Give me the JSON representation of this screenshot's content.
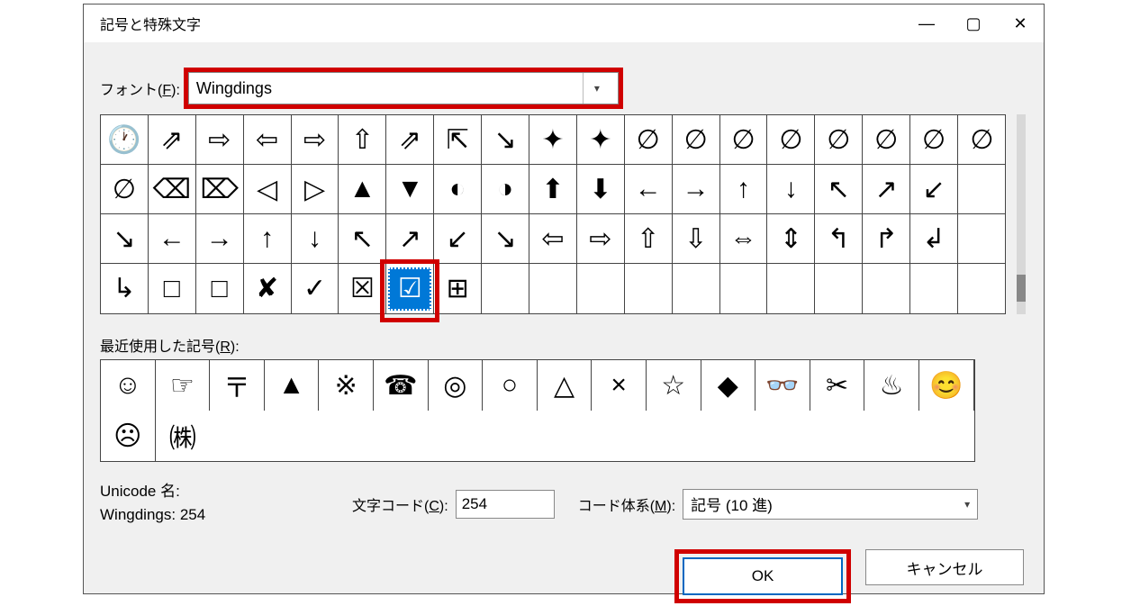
{
  "dialog": {
    "title": "記号と特殊文字"
  },
  "font": {
    "label_prefix": "フォント(",
    "label_key": "F",
    "label_suffix": "):",
    "value": "Wingdings"
  },
  "symbol_grid": {
    "cells": [
      "🕐",
      "⇗",
      "⇨",
      "⇦",
      "⇨",
      "⇧",
      "⇗",
      "⇱",
      "↘",
      "✦",
      "✦",
      "∅",
      "∅",
      "∅",
      "∅",
      "∅",
      "∅",
      "∅",
      "∅",
      "∅",
      "⌫",
      "⌦",
      "◁",
      "▷",
      "▲",
      "▼",
      "◐",
      "◑",
      "⬆",
      "⬇",
      "←",
      "→",
      "↑",
      "↓",
      "↖",
      "↗",
      "↙",
      "",
      "↘",
      "←",
      "→",
      "↑",
      "↓",
      "↖",
      "↗",
      "↙",
      "↘",
      "⇦",
      "⇨",
      "⇧",
      "⇩",
      "⇔",
      "⇕",
      "↰",
      "↱",
      "↲",
      "",
      "↳",
      "□",
      "□",
      "✘",
      "✓",
      "☒",
      "☑",
      "⊞",
      "",
      "",
      "",
      "",
      "",
      "",
      "",
      "",
      "",
      "",
      ""
    ],
    "selected_index": 63
  },
  "recent": {
    "label_prefix": "最近使用した記号(",
    "label_key": "R",
    "label_suffix": "):",
    "cells": [
      "☺",
      "☞",
      "〒",
      "▲",
      "※",
      "☎",
      "◎",
      "○",
      "△",
      "×",
      "☆",
      "◆",
      "👓",
      "✂",
      "♨",
      "😊",
      "☹",
      "㈱"
    ]
  },
  "unicode_label": "Unicode 名:",
  "font_info": "Wingdings: 254",
  "char_code": {
    "label_prefix": "文字コード(",
    "label_key": "C",
    "label_suffix": "):",
    "value": "254"
  },
  "code_system": {
    "label_prefix": "コード体系(",
    "label_key": "M",
    "label_suffix": "):",
    "value": "記号 (10 進)"
  },
  "buttons": {
    "ok": "OK",
    "cancel": "キャンセル"
  }
}
